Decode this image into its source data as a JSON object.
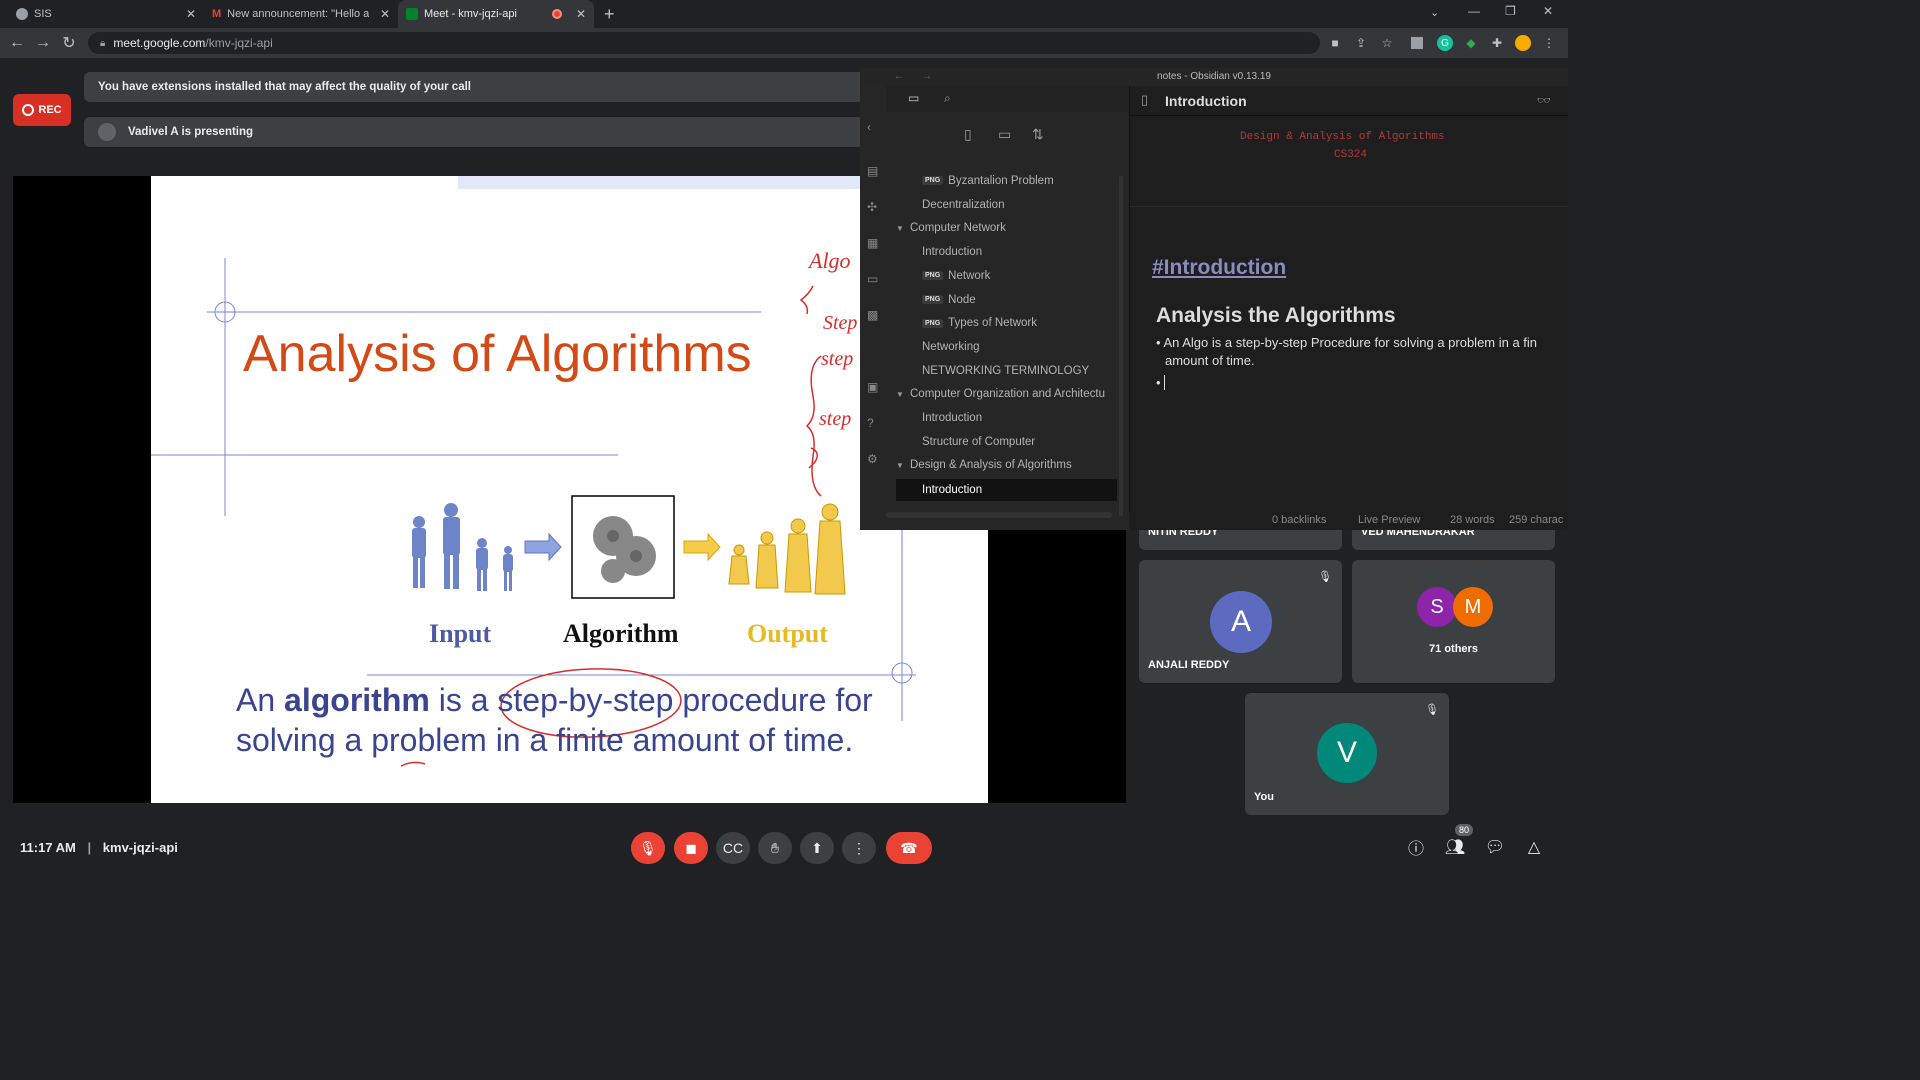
{
  "browser": {
    "tabs": [
      {
        "label": "SIS"
      },
      {
        "label": "New announcement: \"Hello all Th"
      },
      {
        "label": "Meet - kmv-jqzi-api"
      }
    ],
    "url_host": "meet.google.com",
    "url_path": "/kmv-jqzi-api"
  },
  "meet": {
    "rec_label": "REC",
    "banner": "You have extensions installed that may affect the quality of your call",
    "presenting": "Vadivel A is presenting",
    "time": "11:17 AM",
    "separator": "|",
    "meeting_code": "kmv-jqzi-api",
    "participants_count": "80",
    "tiles": [
      {
        "name": "NITIN REDDY"
      },
      {
        "name": "VED MAHENDRAKAR"
      },
      {
        "name": "ANJALI REDDY",
        "initial": "A",
        "color": "#5c6bc0"
      },
      {
        "name": "71 others",
        "initials": [
          "S",
          "M"
        ],
        "colors": [
          "#8e24aa",
          "#ef6c00"
        ]
      },
      {
        "name": "You",
        "initial": "V",
        "color": "#00897b"
      }
    ]
  },
  "slide": {
    "title": "Analysis of Algorithms",
    "input": "Input",
    "algorithm": "Algorithm",
    "output": "Output",
    "def_1": "An ",
    "def_bold": "algorithm",
    "def_2": " is a ",
    "def_3": "step-by-step",
    "def_4": " procedure for",
    "def_line2": "solving a problem in a finite amount of time.",
    "handwriting": [
      "Algo",
      "Step",
      "step",
      "step"
    ]
  },
  "obsidian": {
    "window_title": "notes - Obsidian v0.13.19",
    "png_badge": "PNG",
    "tree": [
      {
        "label": "Byzantalion Problem",
        "png": true,
        "indent": 2
      },
      {
        "label": "Decentralization",
        "indent": 2
      },
      {
        "label": "Computer Network",
        "folder": true,
        "indent": 1
      },
      {
        "label": "Introduction",
        "indent": 2
      },
      {
        "label": "Network",
        "png": true,
        "indent": 2
      },
      {
        "label": "Node",
        "png": true,
        "indent": 2
      },
      {
        "label": "Types of Network",
        "png": true,
        "indent": 2
      },
      {
        "label": "Networking",
        "indent": 2
      },
      {
        "label": "NETWORKING TERMINOLOGY",
        "indent": 2
      },
      {
        "label": "Computer Organization and Architectu",
        "folder": true,
        "indent": 1
      },
      {
        "label": "Introduction",
        "indent": 2
      },
      {
        "label": "Structure of Computer",
        "indent": 2
      },
      {
        "label": "Design & Analysis of Algorithms",
        "folder": true,
        "indent": 1
      },
      {
        "label": "Introduction",
        "indent": 2,
        "selected": true
      }
    ],
    "note_title": "Introduction",
    "header_line1": "Design & Analysis of Algorithms",
    "header_line2": "CS324",
    "tag_heading": "#Introduction",
    "h2": "Analysis the Algorithms",
    "bullet_1a": "An Algo is a step-by-step Procedure for solving a problem in a fin",
    "bullet_1b": "amount of time.",
    "status_backlinks": "0 backlinks",
    "status_mode": "Live Preview",
    "status_words": "28 words",
    "status_chars": "259 charac"
  }
}
